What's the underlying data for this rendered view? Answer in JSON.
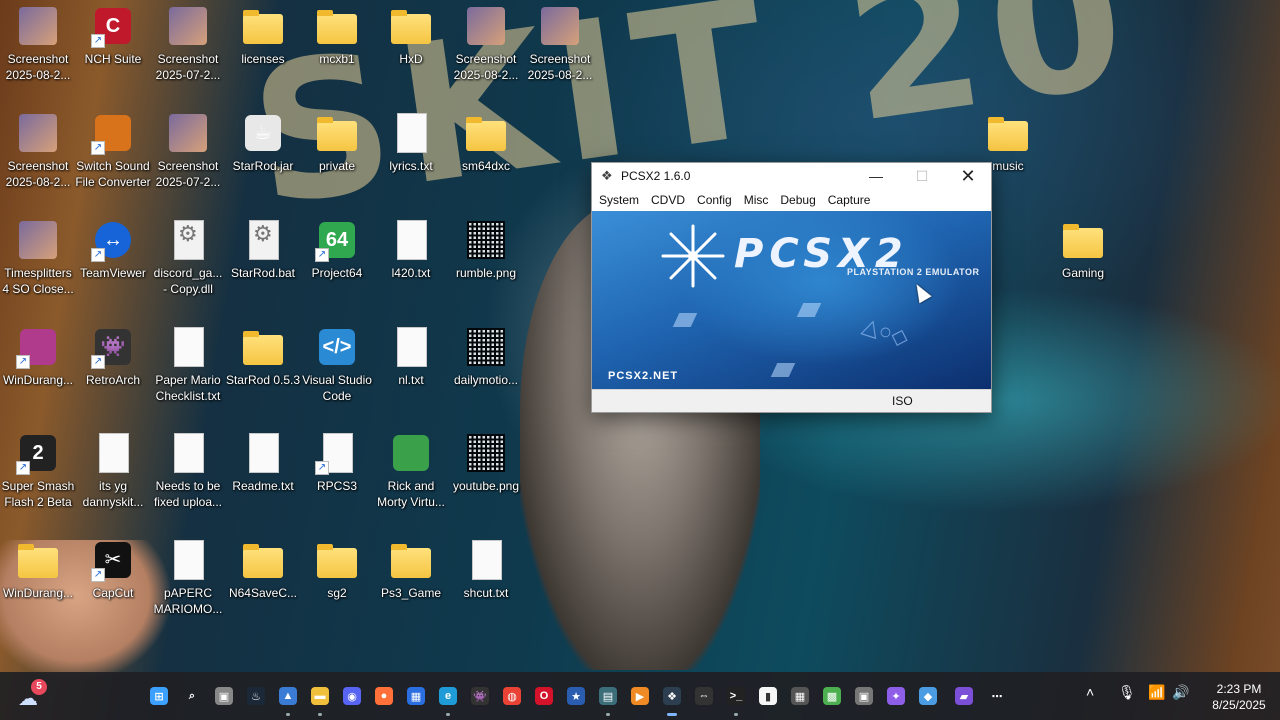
{
  "desktop": {
    "icons": [
      {
        "label": "Screenshot 2025-08-2...",
        "kind": "img"
      },
      {
        "label": "NCH Suite",
        "kind": "app"
      },
      {
        "label": "Screenshot 2025-07-2...",
        "kind": "img"
      },
      {
        "label": "licenses",
        "kind": "folder"
      },
      {
        "label": "mcxb1",
        "kind": "folder"
      },
      {
        "label": "HxD",
        "kind": "folder"
      },
      {
        "label": "Screenshot 2025-08-2...",
        "kind": "img"
      },
      {
        "label": "Screenshot 2025-08-2...",
        "kind": "img"
      },
      {
        "label": "Screenshot 2025-08-2...",
        "kind": "img"
      },
      {
        "label": "Switch Sound File Converter",
        "kind": "app"
      },
      {
        "label": "Screenshot 2025-07-2...",
        "kind": "img"
      },
      {
        "label": "StarRod.jar",
        "kind": "app"
      },
      {
        "label": "private",
        "kind": "folder"
      },
      {
        "label": "lyrics.txt",
        "kind": "doc"
      },
      {
        "label": "sm64dxc",
        "kind": "folder"
      },
      {
        "label": "music",
        "kind": "folder"
      },
      {
        "label": "Timesplitters 4 SO Close...",
        "kind": "img"
      },
      {
        "label": "TeamViewer",
        "kind": "circle"
      },
      {
        "label": "discord_ga... - Copy.dll",
        "kind": "gear"
      },
      {
        "label": "StarRod.bat",
        "kind": "gear"
      },
      {
        "label": "Project64",
        "kind": "app"
      },
      {
        "label": "l420.txt",
        "kind": "doc"
      },
      {
        "label": "rumble.png",
        "kind": "qr"
      },
      {
        "label": "Gaming",
        "kind": "folder"
      },
      {
        "label": "WinDurang...",
        "kind": "app"
      },
      {
        "label": "RetroArch",
        "kind": "app"
      },
      {
        "label": "Paper Mario Checklist.txt",
        "kind": "doc"
      },
      {
        "label": "StarRod 0.5.3",
        "kind": "folder"
      },
      {
        "label": "Visual Studio Code",
        "kind": "app"
      },
      {
        "label": "nl.txt",
        "kind": "doc"
      },
      {
        "label": "dailymotio...",
        "kind": "qr"
      },
      {
        "label": "Super Smash Flash 2 Beta",
        "kind": "app"
      },
      {
        "label": "its yg dannyskit...",
        "kind": "doc"
      },
      {
        "label": "Needs to be fixed uploa...",
        "kind": "doc"
      },
      {
        "label": "Readme.txt",
        "kind": "doc"
      },
      {
        "label": "RPCS3",
        "kind": "doc"
      },
      {
        "label": "Rick and Morty Virtu...",
        "kind": "app"
      },
      {
        "label": "youtube.png",
        "kind": "qr"
      },
      {
        "label": "WinDurang...",
        "kind": "folder"
      },
      {
        "label": "CapCut",
        "kind": "app"
      },
      {
        "label": "pAPERC MARIOMO...",
        "kind": "doc"
      },
      {
        "label": "N64SaveC...",
        "kind": "folder"
      },
      {
        "label": "sg2",
        "kind": "folder"
      },
      {
        "label": "Ps3_Game",
        "kind": "folder"
      },
      {
        "label": "shcut.txt",
        "kind": "doc"
      }
    ]
  },
  "window": {
    "title": "PCSX2  1.6.0",
    "menu": [
      "System",
      "CDVD",
      "Config",
      "Misc",
      "Debug",
      "Capture"
    ],
    "splash_logo": "PCSX2",
    "splash_subtitle": "PLAYSTATION 2 EMULATOR",
    "splash_site": "PCSX2.NET",
    "status": "ISO"
  },
  "taskbar": {
    "weather_badge": "5",
    "apps": [
      "start-icon",
      "search-icon",
      "task-view-icon",
      "steam-icon",
      "photos-icon",
      "file-explorer-icon",
      "discord-icon",
      "firefox-icon",
      "store-icon",
      "edge-icon",
      "retroarch-icon",
      "chrome-icon",
      "opera-icon",
      "app-icon",
      "app-icon",
      "media-player-icon",
      "pcsx2-icon",
      "app-icon",
      "terminal-icon",
      "notepad-icon",
      "calculator-icon",
      "minecraft-icon",
      "app-icon",
      "copilot-icon",
      "app-icon",
      "folder-app-icon",
      "more-icon"
    ],
    "time": "2:23 PM",
    "date": "8/25/2025"
  },
  "colors": {
    "taskbar": "#202024",
    "splash": "#1f64b0",
    "accent": "#7fb6ff"
  }
}
